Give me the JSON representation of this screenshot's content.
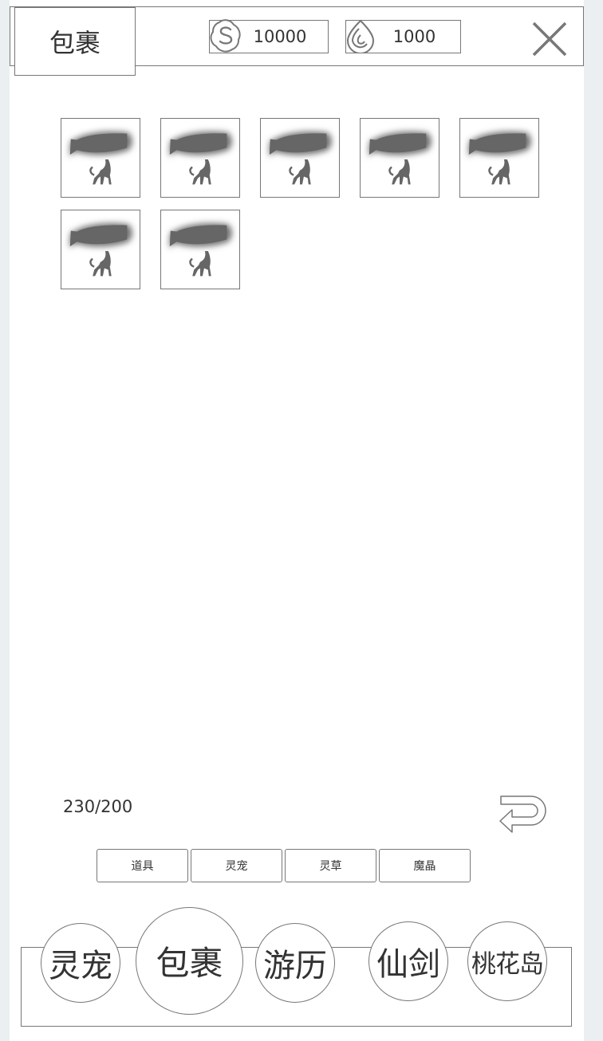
{
  "header": {
    "title": "包裹",
    "coins": {
      "value": "10000",
      "icon": "coin-s-icon"
    },
    "spirit": {
      "value": "1000",
      "icon": "drop-icon"
    },
    "close_icon": "close-icon"
  },
  "inventory": {
    "items": [
      {
        "icon": "pet-silhouette-icon"
      },
      {
        "icon": "pet-silhouette-icon"
      },
      {
        "icon": "pet-silhouette-icon"
      },
      {
        "icon": "pet-silhouette-icon"
      },
      {
        "icon": "pet-silhouette-icon"
      },
      {
        "icon": "pet-silhouette-icon"
      },
      {
        "icon": "pet-silhouette-icon"
      }
    ],
    "capacity": "230/200"
  },
  "tabs": [
    "道具",
    "灵宠",
    "灵草",
    "魔晶"
  ],
  "bottom_nav": [
    "灵宠",
    "包裹",
    "游历",
    "仙剑",
    "桃花岛"
  ]
}
